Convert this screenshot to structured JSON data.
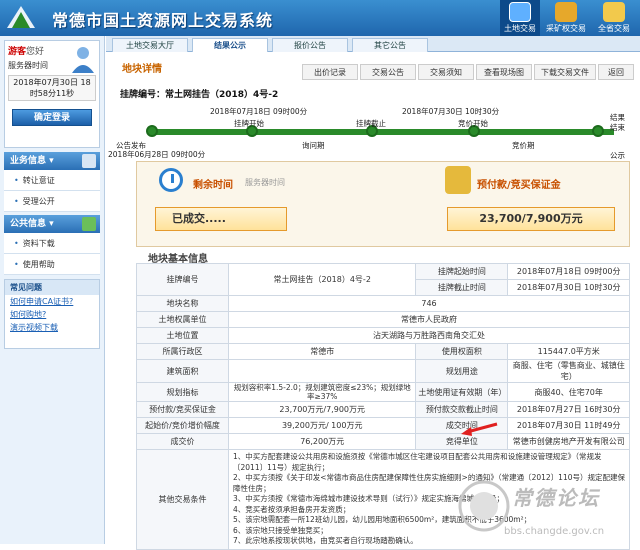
{
  "header": {
    "site_title": "常德市国土资源网上交易系统",
    "buttons": [
      {
        "label": "土地交易",
        "active": true
      },
      {
        "label": "采矿权交易",
        "active": false
      },
      {
        "label": "全省交易",
        "active": false
      }
    ]
  },
  "sidebar": {
    "greeting": "游客",
    "greeting_suffix": "您好",
    "server_time_label": "服务器时间",
    "server_time": "2018年07月30日 18时58分11秒",
    "login_button": "确定登录",
    "business_info": "业务信息",
    "business_items": [
      "转让意证",
      "受理公开"
    ],
    "public_info": "公共信息",
    "public_items": [
      "资料下载",
      "使用帮助"
    ],
    "faq_title": "常见问题",
    "faq_links": [
      "如何申请CA证书?",
      "如何购地?",
      "演示视频下载"
    ]
  },
  "tabs": [
    "土地交易大厅",
    "结果公示",
    "报价公告",
    "其它公告"
  ],
  "land_info_title": "地块详情",
  "subtabs": [
    "出价记录",
    "交易公告",
    "交易须知",
    "查看现场图",
    "下载交易文件",
    "返回"
  ],
  "lot_heading": "挂牌编号：常土网挂告（2018）4号-2",
  "timeline": {
    "top_labels": [
      "2018年07月18日 09时00分",
      "2018年07月30日 10时30分"
    ],
    "top_stage": [
      "挂牌开始",
      "挂牌截止",
      "竞价开始"
    ],
    "bottom_stage": [
      "公告发布",
      "询问期",
      "竞价期"
    ],
    "pub_date": "2018年06月28日 09时00分",
    "end_labels": [
      "结果",
      "结束",
      "公示"
    ]
  },
  "panel": {
    "remaining_label": "剩余时间",
    "server_time": "服务器时间",
    "remaining_value": "已成交.....",
    "deposit_label": "预付款/竞买保证金",
    "deposit_value": "23,700/7,900万元"
  },
  "section_title": "地块基本信息",
  "table": {
    "r1": [
      "挂牌编号",
      "常土网挂告（2018）4号-2",
      "挂牌起始时间",
      "2018年07月18日 09时00分"
    ],
    "r2": [
      "挂牌截止时间",
      "2018年07月30日 10时30分"
    ],
    "r3": [
      "地块名称",
      "746"
    ],
    "r4": [
      "土地权属单位",
      "常德市人民政府"
    ],
    "r5": [
      "土地位置",
      "沾天湖路与万胜路西南角交汇处"
    ],
    "r6": [
      "所属行政区",
      "常德市",
      "使用权面积",
      "115447.0平方米"
    ],
    "r7": [
      "建筑面积",
      "",
      "规划用途",
      "商服、住宅（零售商业、城镇住宅）"
    ],
    "r8": [
      "规划指标",
      "规划容积率1.5-2.0；规划建筑密度≤23%；规划绿地率≥37%",
      "土地使用证有效期（年）",
      "商服40、住宅70年"
    ],
    "r9": [
      "预付款/竞买保证金",
      "23,700万元/7,900万元",
      "预付款交款截止时间",
      "2018年07月27日 16时30分"
    ],
    "r10": [
      "起始价/竞价增价幅度",
      "39,200万元/ 100万元",
      "成交时间",
      "2018年07月30日 11时49分"
    ],
    "r11": [
      "成交价",
      "76,200万元",
      "竞得单位",
      "常德市创健房地产开发有限公司"
    ],
    "other_label": "其他交易条件",
    "other_lines": [
      "1、中买方配套建设公共用房和设施须按《常德市城区住宅建设项目配套公共用房和设施建设管理规定》（常规发〔2011〕11号）规定执行；",
      "2、中买方须按《关于印发<常德市商品住房配建保障性住房实施细则>的通知》（常建通〔2012〕110号）规定配建保障性住房；",
      "3、中买方须按《常德市海绵城市建设技术导则（试行）》规定实施海绵城市建设；",
      "4、竞买者按须承担备房开发资质；",
      "5、该宗地需配套一所12班幼儿园，幼儿园用地面积6500m²，建筑面积不低于3600m²；",
      "6、该宗地只接受单独竞买；",
      "7、此宗地系按现状供地，由竞买者自行现场踏勘确认。"
    ]
  },
  "watermark": {
    "text": "常德论坛",
    "url": "bbs.changde.gov.cn"
  }
}
